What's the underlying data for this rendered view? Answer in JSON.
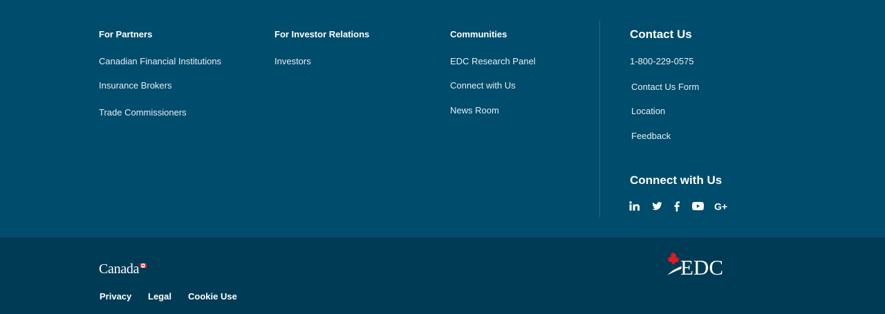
{
  "partners": {
    "title": "For Partners",
    "links": [
      "Canadian Financial Institutions",
      "Insurance Brokers",
      "Trade Commissioners"
    ]
  },
  "investor": {
    "title": "For Investor Relations",
    "links": [
      "Investors"
    ]
  },
  "communities": {
    "title": "Communities",
    "links": [
      "EDC Research Panel",
      "Connect with Us",
      "News Room"
    ]
  },
  "contact": {
    "title": "Contact Us",
    "links": [
      "1-800-229-0575",
      "Contact Us Form",
      "Location",
      "Feedback"
    ]
  },
  "connect": {
    "title": "Connect with Us",
    "icons": [
      "linkedin-icon",
      "twitter-icon",
      "facebook-icon",
      "youtube-icon",
      "google-plus-icon"
    ]
  },
  "footer": {
    "wordmark": "Canada",
    "legal_links": [
      "Privacy",
      "Legal",
      "Cookie Use"
    ],
    "logo_text": "EDC"
  },
  "colors": {
    "background": "#004c6c",
    "bottom_bar": "#003b56",
    "maple_red": "#e11b22"
  }
}
